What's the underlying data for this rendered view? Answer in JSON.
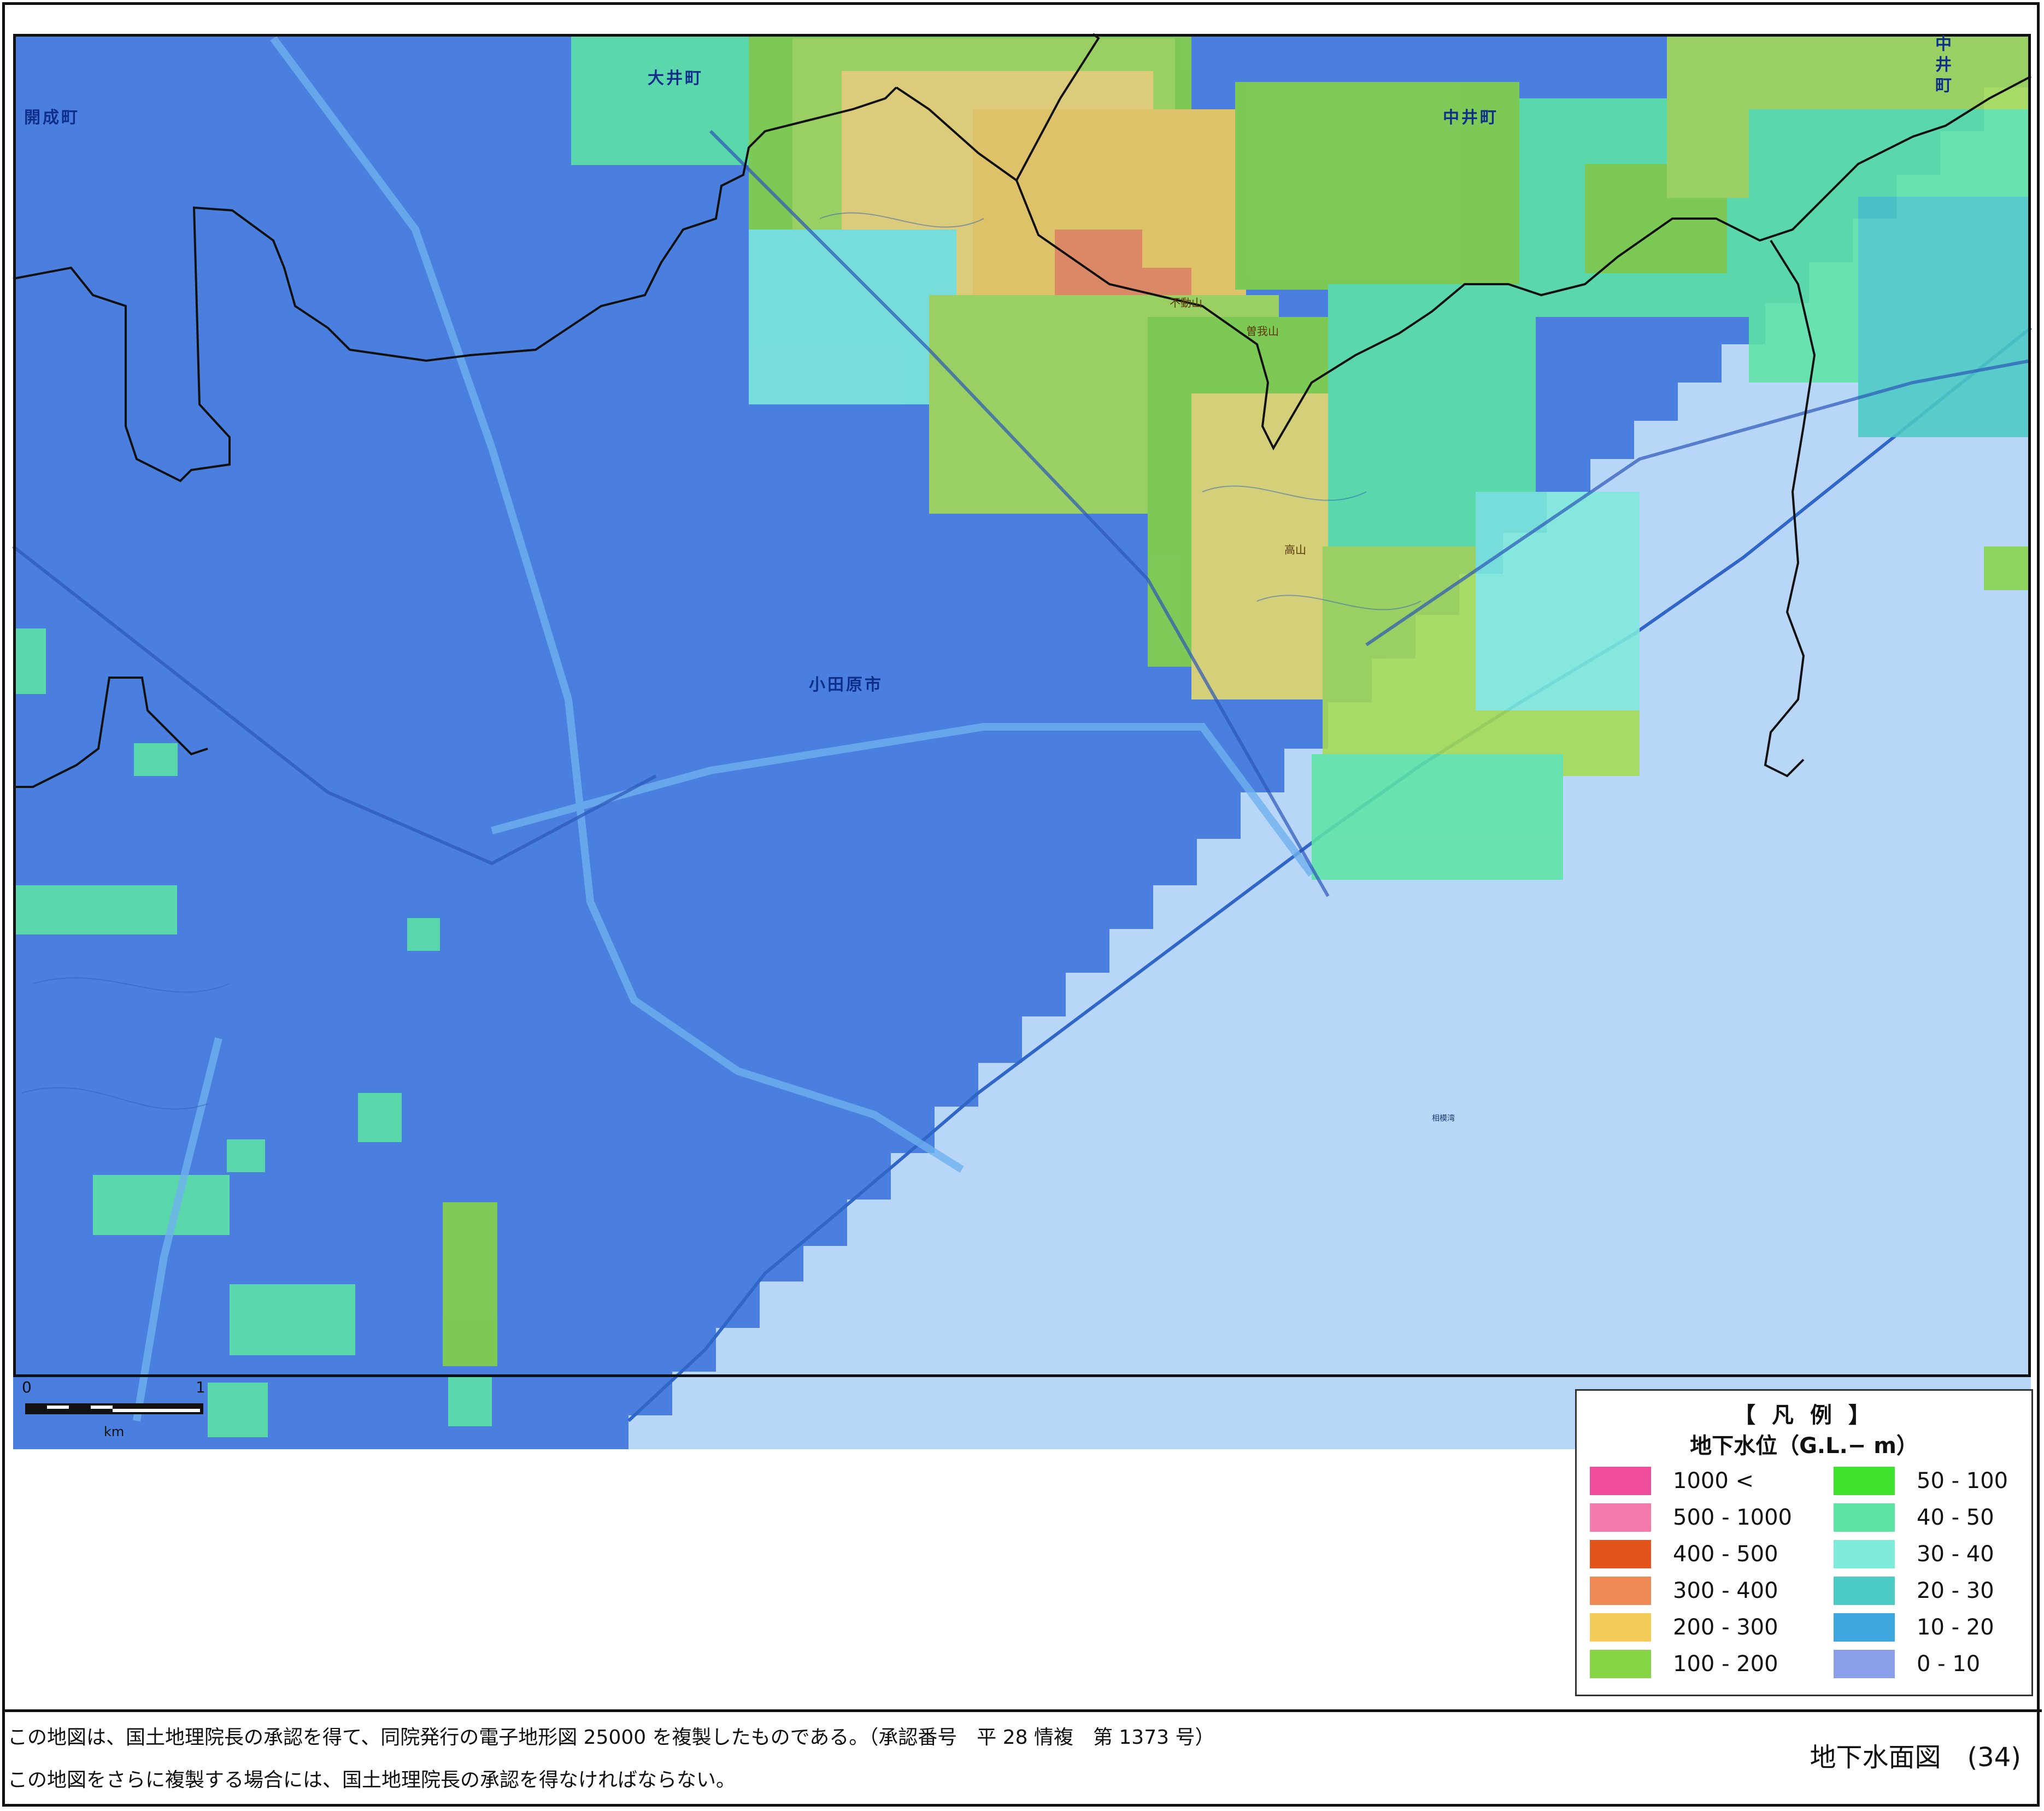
{
  "map": {
    "towns": {
      "kaisei": "開成町",
      "oi": "大井町",
      "nakai": "中井町",
      "nakai_vertical": "中井町",
      "odawara": "小田原市"
    },
    "peaks": {
      "fudosan": "不動山",
      "kabasan": "高山",
      "tatsuyama": "曽我山"
    },
    "sea_label": "相模湾",
    "colors": {
      "land_base": "#4a7fe0",
      "sea": "#b8d6f8",
      "boundary": "#111111",
      "river": "#5fa0e8"
    }
  },
  "scale_bar": {
    "start_label": "0",
    "end_label": "1",
    "unit": "km"
  },
  "legend": {
    "title": "【 凡 例 】",
    "subtitle": "地下水位（G.L.− m）",
    "items_left": [
      {
        "label": "1000 <",
        "color": "#f04c9c"
      },
      {
        "label": "500 - 1000",
        "color": "#f47aac"
      },
      {
        "label": "400 - 500",
        "color": "#e2541c"
      },
      {
        "label": "300 - 400",
        "color": "#ef8a56"
      },
      {
        "label": "200 - 300",
        "color": "#f3cc5a"
      },
      {
        "label": "100 - 200",
        "color": "#85d444"
      }
    ],
    "items_right": [
      {
        "label": "50 - 100",
        "color": "#3fe22c"
      },
      {
        "label": "40 - 50",
        "color": "#5de4a4"
      },
      {
        "label": "30 - 40",
        "color": "#7eeada"
      },
      {
        "label": "20 - 30",
        "color": "#4ccac4"
      },
      {
        "label": "10 - 20",
        "color": "#3ea6de"
      },
      {
        "label": "0 - 10",
        "color": "#8a9eea"
      }
    ]
  },
  "footer": {
    "note1": "この地図は、国土地理院長の承認を得て、同院発行の電子地形図 25000 を複製したものである。（承認番号　平 28 情複　第 1373 号）",
    "note2": "この地図をさらに複製する場合には、国土地理院長の承認を得なければならない。",
    "sheet_title": "地下水面図　(34)"
  }
}
